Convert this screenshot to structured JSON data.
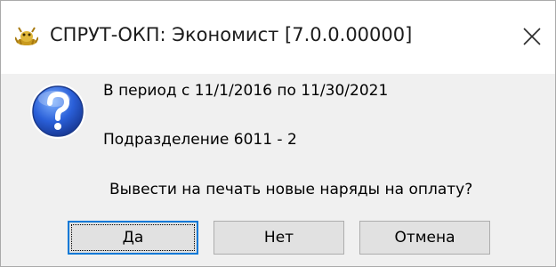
{
  "window": {
    "title": "СПРУТ-ОКП: Экономист [7.0.0.00000]",
    "app_icon": "sprut-app-icon",
    "close_icon": "close-icon"
  },
  "message": {
    "icon": "question-icon",
    "period": "В период с 11/1/2016 по 11/30/2021",
    "department": "Подразделение 6011   -   2",
    "question": "Вывести на печать новые наряды на оплату?"
  },
  "buttons": {
    "yes": "Да",
    "no": "Нет",
    "cancel": "Отмена"
  },
  "colors": {
    "accent": "#0078d7",
    "dialog_bg": "#f0f0f0",
    "button_bg": "#e1e1e1"
  }
}
